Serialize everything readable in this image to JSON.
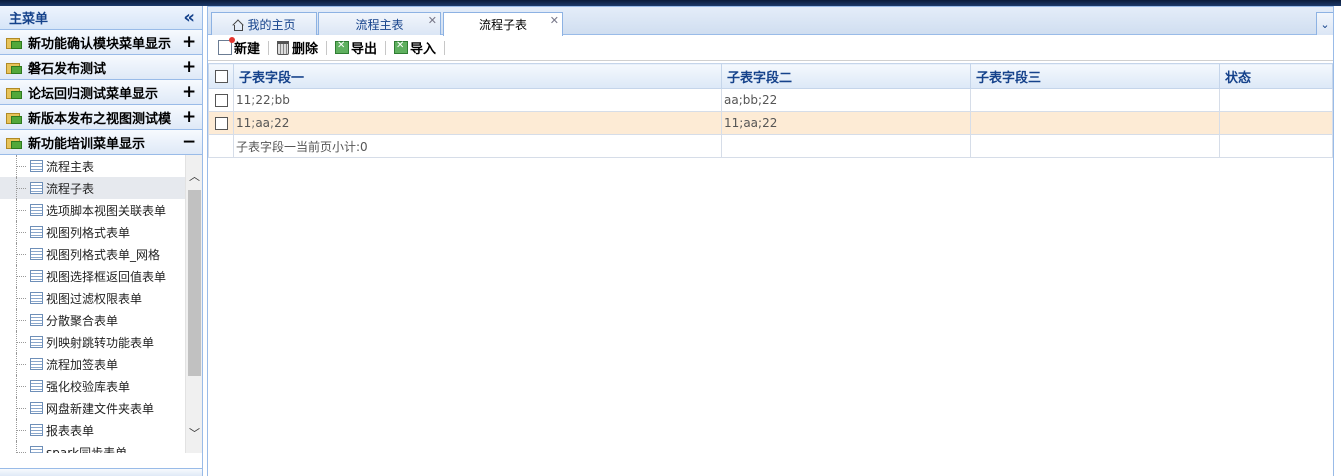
{
  "sidebar": {
    "title": "主菜单",
    "collapse_icon": "double-chevron-left-icon",
    "accordion": [
      {
        "label": "新功能确认模块菜单显示",
        "toggle": "+"
      },
      {
        "label": "磐石发布测试",
        "toggle": "+"
      },
      {
        "label": "论坛回归测试菜单显示",
        "toggle": "+"
      },
      {
        "label": "新版本发布之视图测试模",
        "toggle": "+"
      },
      {
        "label": "新功能培训菜单显示",
        "toggle": "−"
      }
    ],
    "tree": [
      {
        "label": "流程主表",
        "selected": false
      },
      {
        "label": "流程子表",
        "selected": true
      },
      {
        "label": "选项脚本视图关联表单",
        "selected": false
      },
      {
        "label": "视图列格式表单",
        "selected": false
      },
      {
        "label": "视图列格式表单_网格",
        "selected": false
      },
      {
        "label": "视图选择框返回值表单",
        "selected": false
      },
      {
        "label": "视图过滤权限表单",
        "selected": false
      },
      {
        "label": "分散聚合表单",
        "selected": false
      },
      {
        "label": "列映射跳转功能表单",
        "selected": false
      },
      {
        "label": "流程加签表单",
        "selected": false
      },
      {
        "label": "强化校验库表单",
        "selected": false
      },
      {
        "label": "网盘新建文件夹表单",
        "selected": false
      },
      {
        "label": "报表表单",
        "selected": false
      },
      {
        "label": "spark同步表单",
        "selected": false
      }
    ]
  },
  "tabs": [
    {
      "label": "我的主页",
      "icon": "home-icon",
      "closable": false,
      "active": false
    },
    {
      "label": "流程主表",
      "closable": true,
      "active": false
    },
    {
      "label": "流程子表",
      "closable": true,
      "active": true
    }
  ],
  "tab_menu_icon": "chevron-down-icon",
  "toolbar": {
    "new_label": "新建",
    "delete_label": "删除",
    "export_label": "导出",
    "import_label": "导入"
  },
  "grid": {
    "columns": [
      "子表字段一",
      "子表字段二",
      "子表字段三",
      "状态"
    ],
    "rows": [
      {
        "c1": [
          "11",
          "22",
          "bb"
        ],
        "c2": "aa;bb;22",
        "c3": "",
        "status": ""
      },
      {
        "c1": [
          "11",
          "aa",
          "22"
        ],
        "c2": "11;aa;22",
        "c3": "",
        "status": ""
      }
    ],
    "summary": "子表字段一当前页小计:0"
  },
  "colors": {
    "header_text": "#15428b",
    "border": "#99bbe8",
    "alt_row": "#fdebd5",
    "red_value": "#dd3333"
  }
}
